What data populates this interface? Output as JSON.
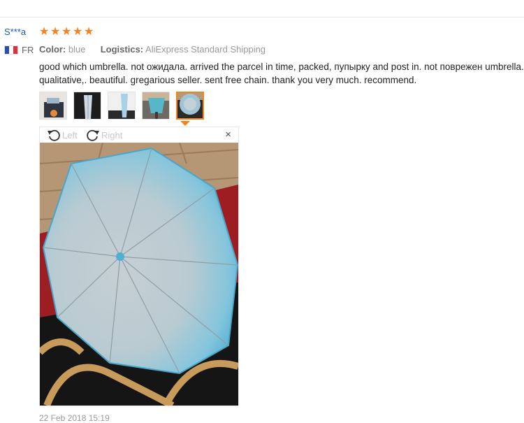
{
  "review": {
    "username": "S***a",
    "rating": 5,
    "country": "FR",
    "color_label": "Color:",
    "color_value": "blue",
    "logistics_label": "Logistics:",
    "logistics_value": "AliExpress Standard Shipping",
    "text": "good which umbrella. not ожидала. arrived the parcel in time, packed, пупырку and post in. not поврежен umbrella. qualitative,. beautiful. gregarious seller. sent free chain. thank you very much. recommend.",
    "date": "22 Feb 2018 15:19"
  },
  "thumbnails": {
    "count": 5,
    "active_index": 4
  },
  "viewer": {
    "rotate_left_label": "Left",
    "rotate_right_label": "Right",
    "close_symbol": "×"
  },
  "icons": {
    "star": "star-icon",
    "flag": "france-flag-icon",
    "rotate_left": "rotate-left-icon",
    "rotate_right": "rotate-right-icon",
    "close": "close-icon"
  },
  "colors": {
    "username": "#1a58b5",
    "star": "#f5811f",
    "active_border": "#f5811f",
    "muted_text": "#999999",
    "body_text": "#222222"
  }
}
